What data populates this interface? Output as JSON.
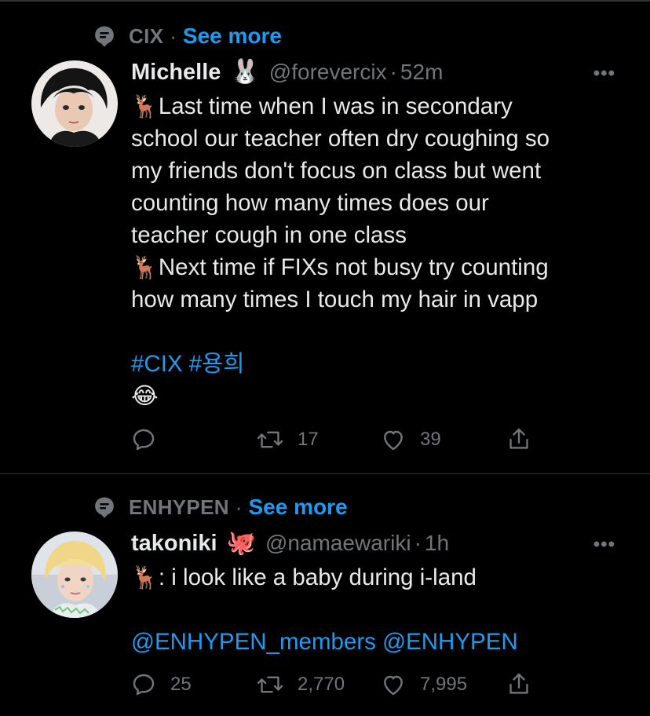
{
  "tweets": [
    {
      "social_context": {
        "label": "CIX",
        "separator": "·",
        "see_more": "See more"
      },
      "author": {
        "name": "Michelle",
        "name_emoji": "🐰",
        "handle": "@forevercix",
        "separator": "·",
        "time": "52m"
      },
      "more": "•••",
      "text_lines": [
        {
          "emoji": "🦌",
          "text": "Last time when I was in secondary"
        },
        {
          "emoji": "",
          "text": "school our teacher often dry coughing so"
        },
        {
          "emoji": "",
          "text": "my friends don't focus on class but went"
        },
        {
          "emoji": "",
          "text": "counting how many times does our"
        },
        {
          "emoji": "",
          "text": "teacher cough in one class"
        },
        {
          "emoji": "🦌",
          "text": "Next time if FIXs not busy try counting"
        },
        {
          "emoji": "",
          "text": "how many times I touch my hair in vapp"
        }
      ],
      "hashtags": "#CIX #용희",
      "end_emoji": "😂",
      "actions": {
        "reply": "",
        "retweet": "17",
        "like": "39"
      }
    },
    {
      "social_context": {
        "label": "ENHYPEN",
        "separator": "·",
        "see_more": "See more"
      },
      "author": {
        "name": "takoniki",
        "name_emoji": "🐙",
        "handle": "@namaewariki",
        "separator": "·",
        "time": "1h"
      },
      "more": "•••",
      "text_lines": [
        {
          "emoji": "🦌",
          "text": ": i look like a baby during i-land"
        }
      ],
      "mentions": "@ENHYPEN_members @ENHYPEN",
      "actions": {
        "reply": "25",
        "retweet": "2,770",
        "like": "7,995"
      }
    }
  ],
  "colors": {
    "background": "#000000",
    "text": "#e7e9ea",
    "secondary": "#71767b",
    "link": "#1d9bf0",
    "divider": "#2f3336"
  },
  "icons": {
    "social": "topic-icon",
    "reply": "reply-icon",
    "retweet": "retweet-icon",
    "like": "heart-icon",
    "share": "share-icon"
  }
}
